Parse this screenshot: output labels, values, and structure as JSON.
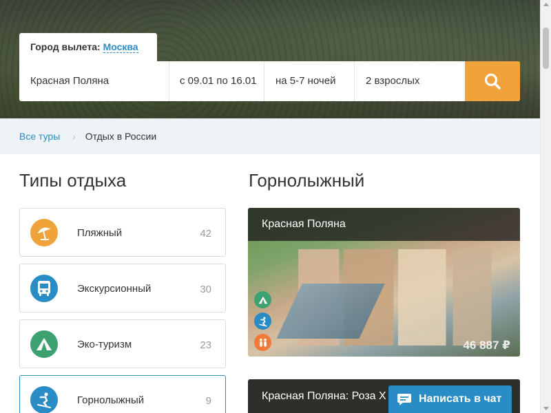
{
  "search": {
    "origin_label": "Город вылета:",
    "origin_city": "Москва",
    "destination": "Красная Поляна",
    "dates": "с 09.01 по 16.01",
    "nights": "на 5-7 ночей",
    "guests": "2 взрослых",
    "button_icon": "search-icon"
  },
  "breadcrumbs": {
    "items": [
      {
        "label": "Все туры"
      },
      {
        "label": "Отдых в России"
      }
    ]
  },
  "sidebar": {
    "title": "Типы отдыха",
    "types": [
      {
        "label": "Пляжный",
        "count": "42",
        "icon": "beach-umbrella-icon",
        "color": "#f0a33b"
      },
      {
        "label": "Экскурсионный",
        "count": "30",
        "icon": "bus-icon",
        "color": "#2a8cc4"
      },
      {
        "label": "Эко-туризм",
        "count": "23",
        "icon": "tent-icon",
        "color": "#3ea172"
      },
      {
        "label": "Горнолыжный",
        "count": "9",
        "icon": "skier-icon",
        "color": "#2a8cc4"
      }
    ]
  },
  "main": {
    "title": "Горнолыжный",
    "cards": [
      {
        "title": "Красная Поляна",
        "price": "46 887 ₽",
        "tags": [
          {
            "icon": "tent-icon",
            "color": "#3ea172"
          },
          {
            "icon": "skier-icon",
            "color": "#2a8cc4"
          },
          {
            "icon": "family-icon",
            "color": "#f07a3a"
          }
        ]
      },
      {
        "title": "Красная Поляна: Роза Х"
      }
    ]
  },
  "chat": {
    "label": "Написать в чат",
    "icon": "chat-icon"
  }
}
